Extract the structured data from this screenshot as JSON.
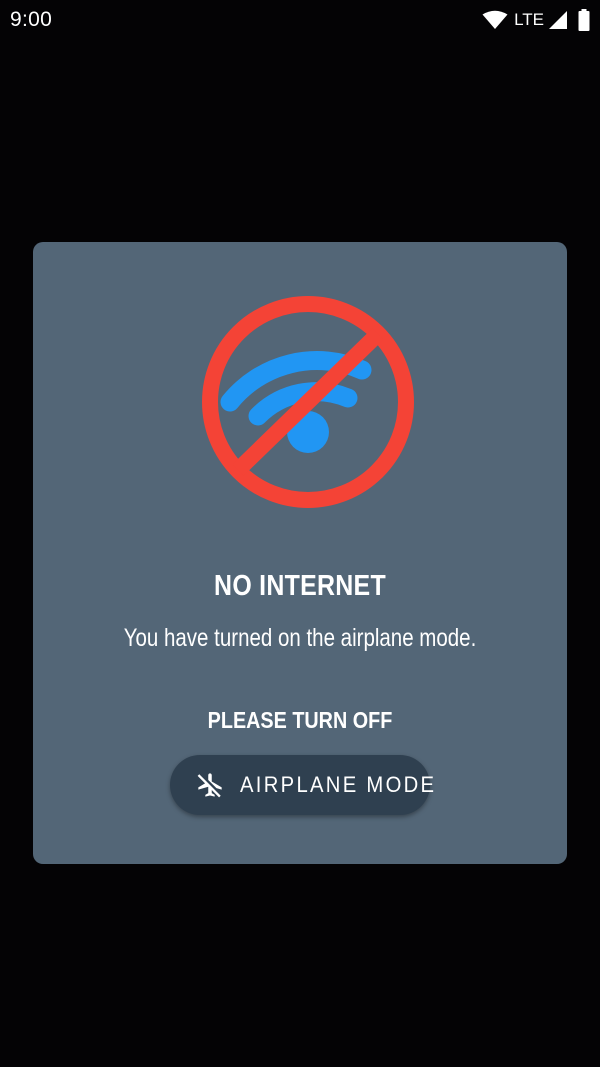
{
  "status_bar": {
    "time": "9:00",
    "network_label": "LTE",
    "icons": [
      "wifi-icon",
      "cellular-signal-icon",
      "battery-icon"
    ]
  },
  "dialog": {
    "title": "NO INTERNET",
    "message": "You have turned on the airplane mode.",
    "instruction": "PLEASE TURN OFF",
    "button_label": "AIRPLANE MODE",
    "illustration_icon": "no-wifi-icon",
    "button_icon": "airplane-off-icon"
  },
  "colors": {
    "background": "#040305",
    "dialog": "#536677",
    "button": "#2f4050",
    "prohibition_red": "#f44336",
    "wifi_blue": "#2196f3",
    "text": "#ffffff"
  }
}
